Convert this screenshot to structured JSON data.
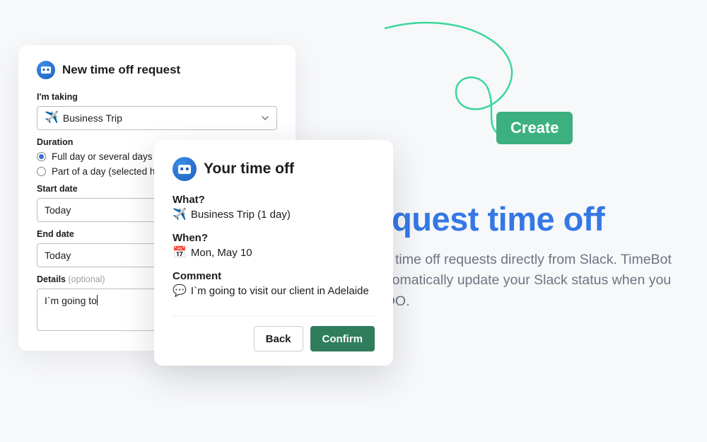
{
  "request_card": {
    "title": "New time off request",
    "type_label": "I'm taking",
    "type_selected": "Business Trip",
    "type_icon": "✈️",
    "duration_label": "Duration",
    "duration_options": {
      "full": "Full day or several days",
      "part": "Part of a day (selected hours)"
    },
    "duration_selected": "full",
    "start_label": "Start date",
    "start_value": "Today",
    "end_label": "End date",
    "end_value": "Today",
    "details_label": "Details",
    "details_optional": "(optional)",
    "details_value": "I`m going to"
  },
  "confirm_card": {
    "title": "Your time off",
    "what_label": "What?",
    "what_icon": "✈️",
    "what_value": "Business Trip (1 day)",
    "when_label": "When?",
    "when_icon": "📅",
    "when_value": "Mon, May 10",
    "comment_label": "Comment",
    "comment_icon": "💬",
    "comment_value": "I`m going to visit our client in Adelaide",
    "back_label": "Back",
    "confirm_label": "Confirm"
  },
  "marketing": {
    "create_badge": "Create",
    "headline": "Request time off",
    "subtext": "Create time off requests directly from Slack. TimeBot will automatically update your Slack status when you are OOO."
  },
  "colors": {
    "accent_blue": "#3478e5",
    "accent_green": "#3cb081",
    "confirm_green": "#2f7d5d"
  }
}
